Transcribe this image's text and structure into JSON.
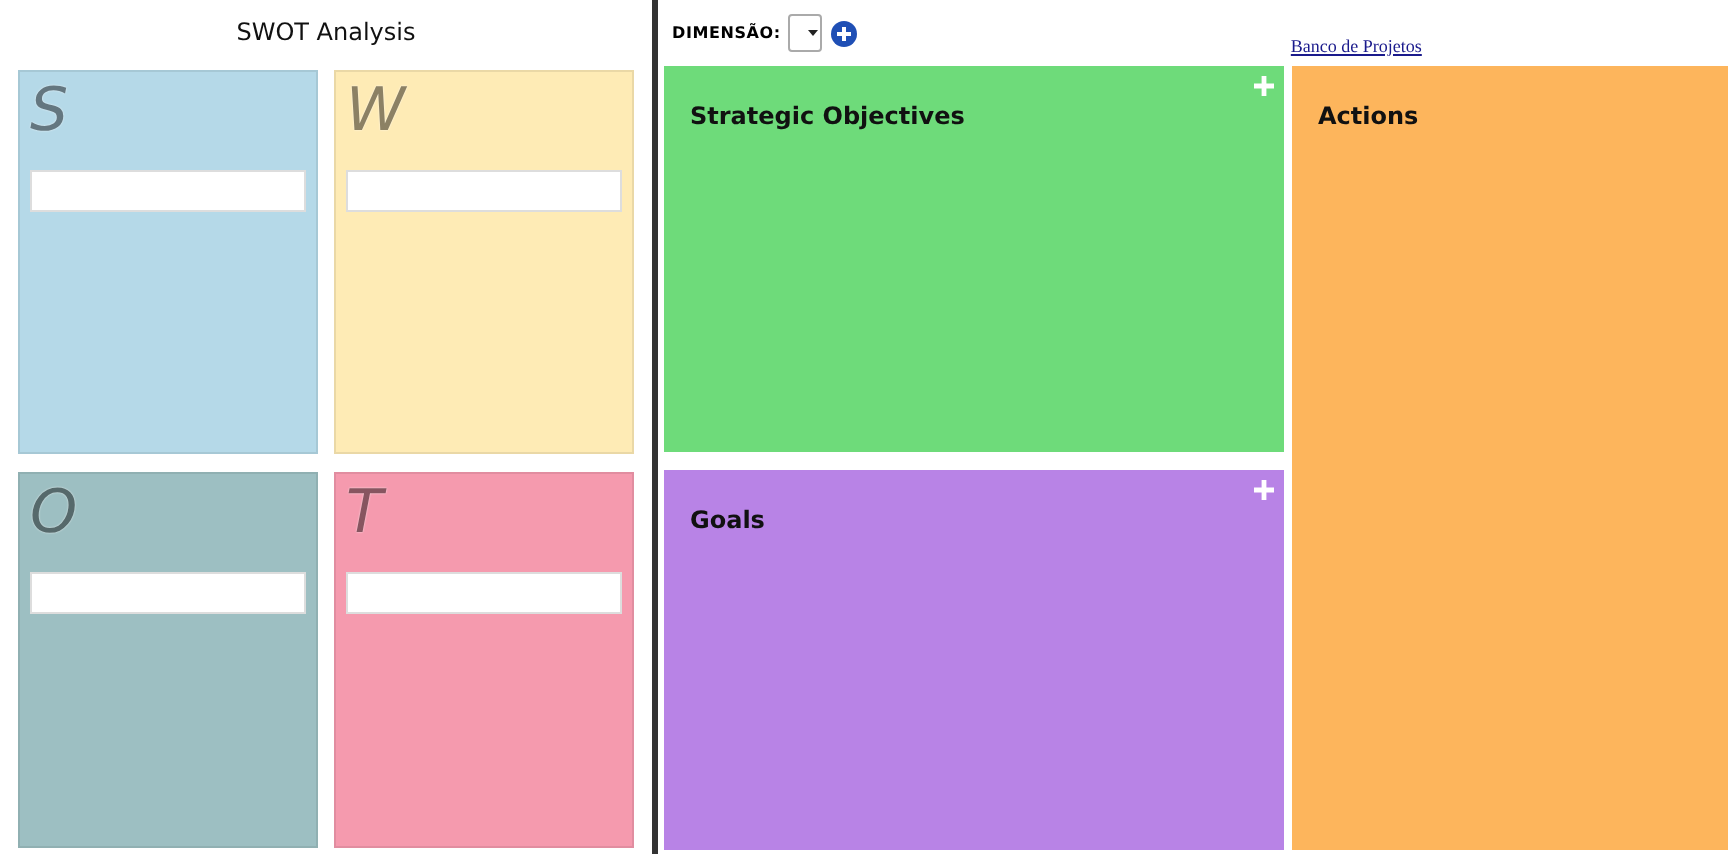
{
  "swot": {
    "title": "SWOT Analysis",
    "quadrants": [
      {
        "letter": "S",
        "color": "#b5d9e8"
      },
      {
        "letter": "W",
        "color": "#feebb5"
      },
      {
        "letter": "O",
        "color": "#9dbfc2"
      },
      {
        "letter": "T",
        "color": "#f59aae"
      }
    ]
  },
  "toolbar": {
    "label": "DIMENSÃO:",
    "link": "Banco de Projetos"
  },
  "boards": [
    {
      "title": "Strategic Objectives",
      "color": "#6edb7a"
    },
    {
      "title": "Goals",
      "color": "#b883e6"
    },
    {
      "title": "Actions",
      "color": "#fdb55c"
    }
  ]
}
